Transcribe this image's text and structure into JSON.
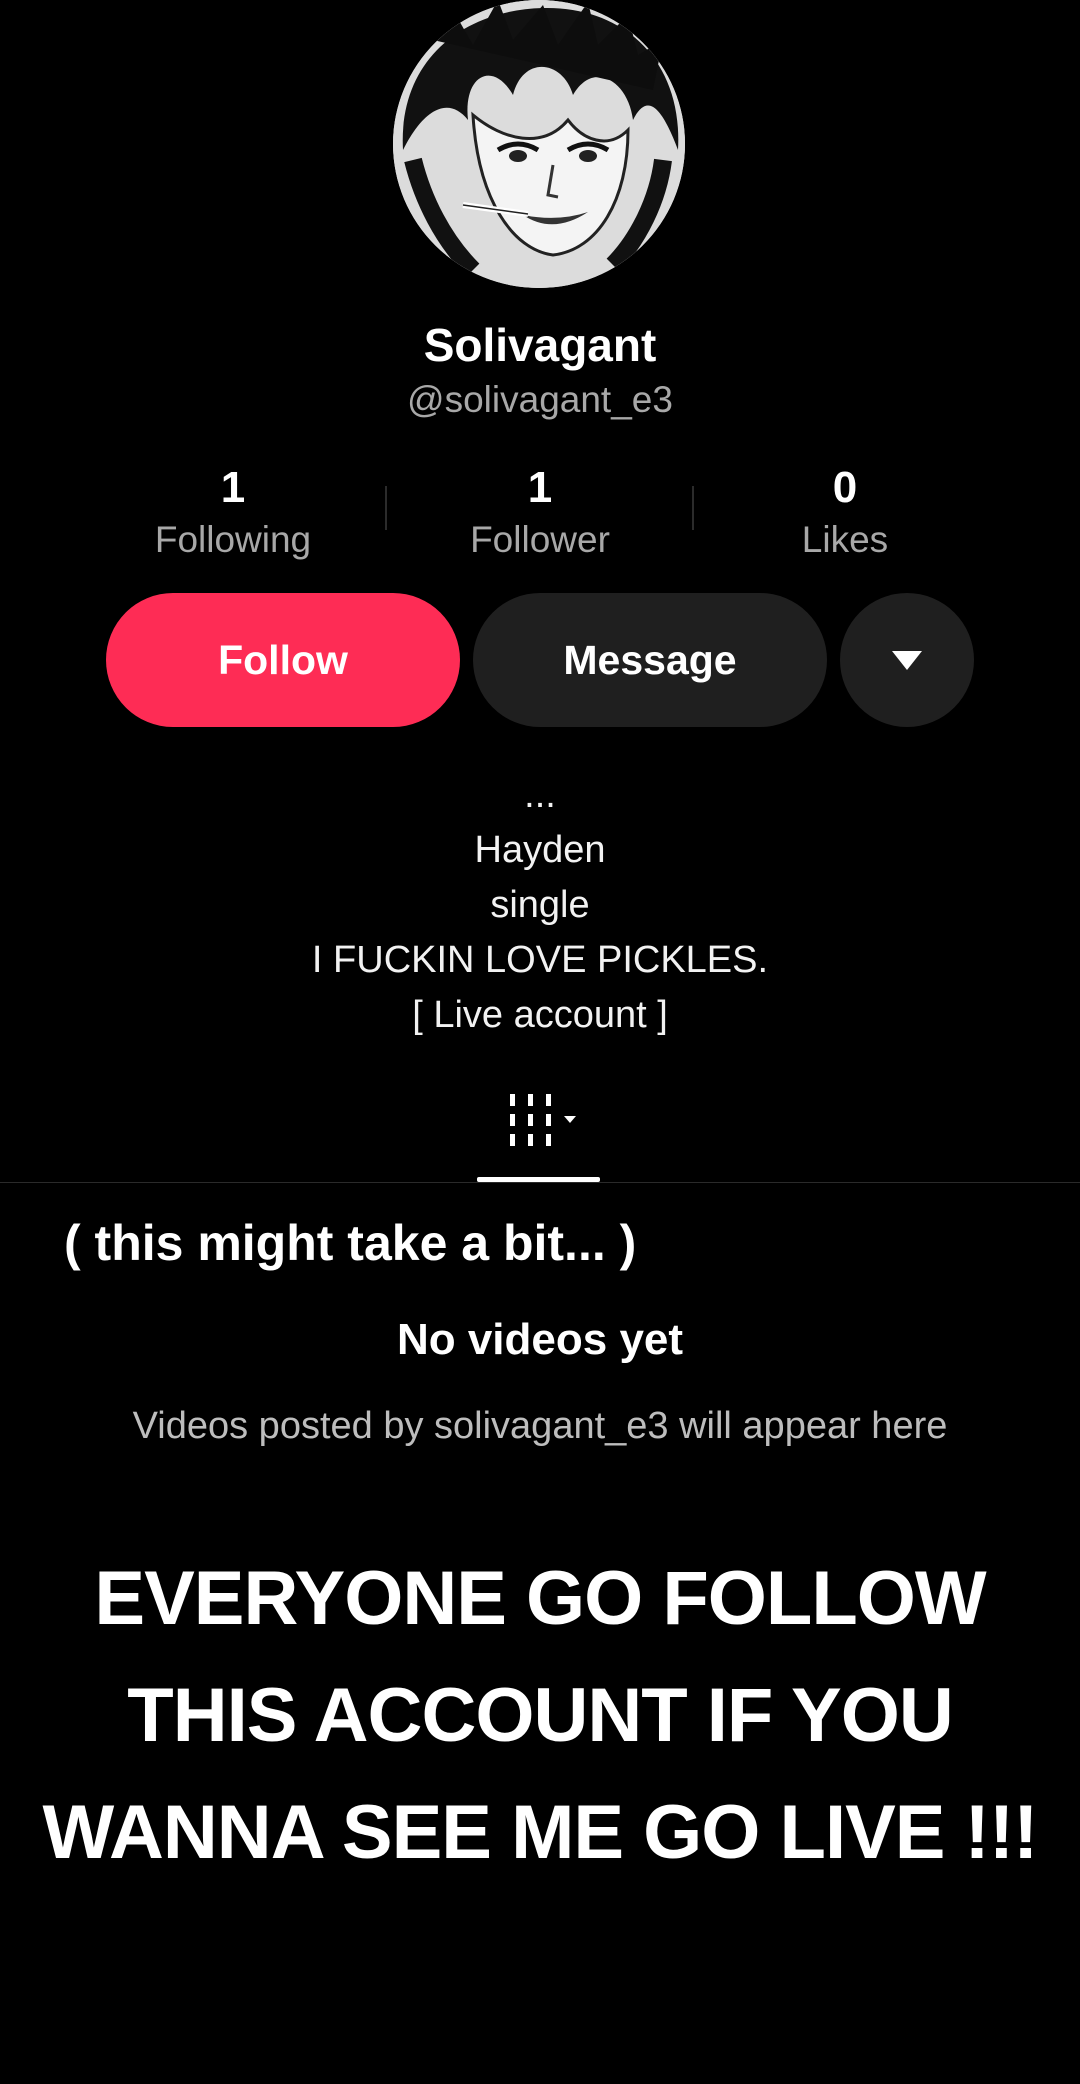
{
  "profile": {
    "display_name": "Solivagant",
    "username": "@solivagant_e3"
  },
  "stats": [
    {
      "value": "1",
      "label": "Following"
    },
    {
      "value": "1",
      "label": "Follower"
    },
    {
      "value": "0",
      "label": "Likes"
    }
  ],
  "actions": {
    "follow_label": "Follow",
    "message_label": "Message",
    "more_icon": "caret-down-icon"
  },
  "colors": {
    "follow_accent": "#fe2c55",
    "secondary_button": "#1f1f1f",
    "muted_text": "#a8a8a8"
  },
  "bio": {
    "lines": [
      "...",
      "Hayden",
      "single",
      "I FUCKIN LOVE PICKLES.",
      "[ Live account ]"
    ]
  },
  "tabs": {
    "videos_icon": "grid-icon"
  },
  "overlay_notes": {
    "top_note": "( this might take a bit... )",
    "big_caption_lines": [
      "EVERYONE GO FOLLOW",
      "THIS ACCOUNT IF YOU",
      "WANNA SEE ME GO LIVE !!!"
    ]
  },
  "empty_state": {
    "title": "No videos yet",
    "description": "Videos posted by solivagant_e3 will appear here"
  }
}
